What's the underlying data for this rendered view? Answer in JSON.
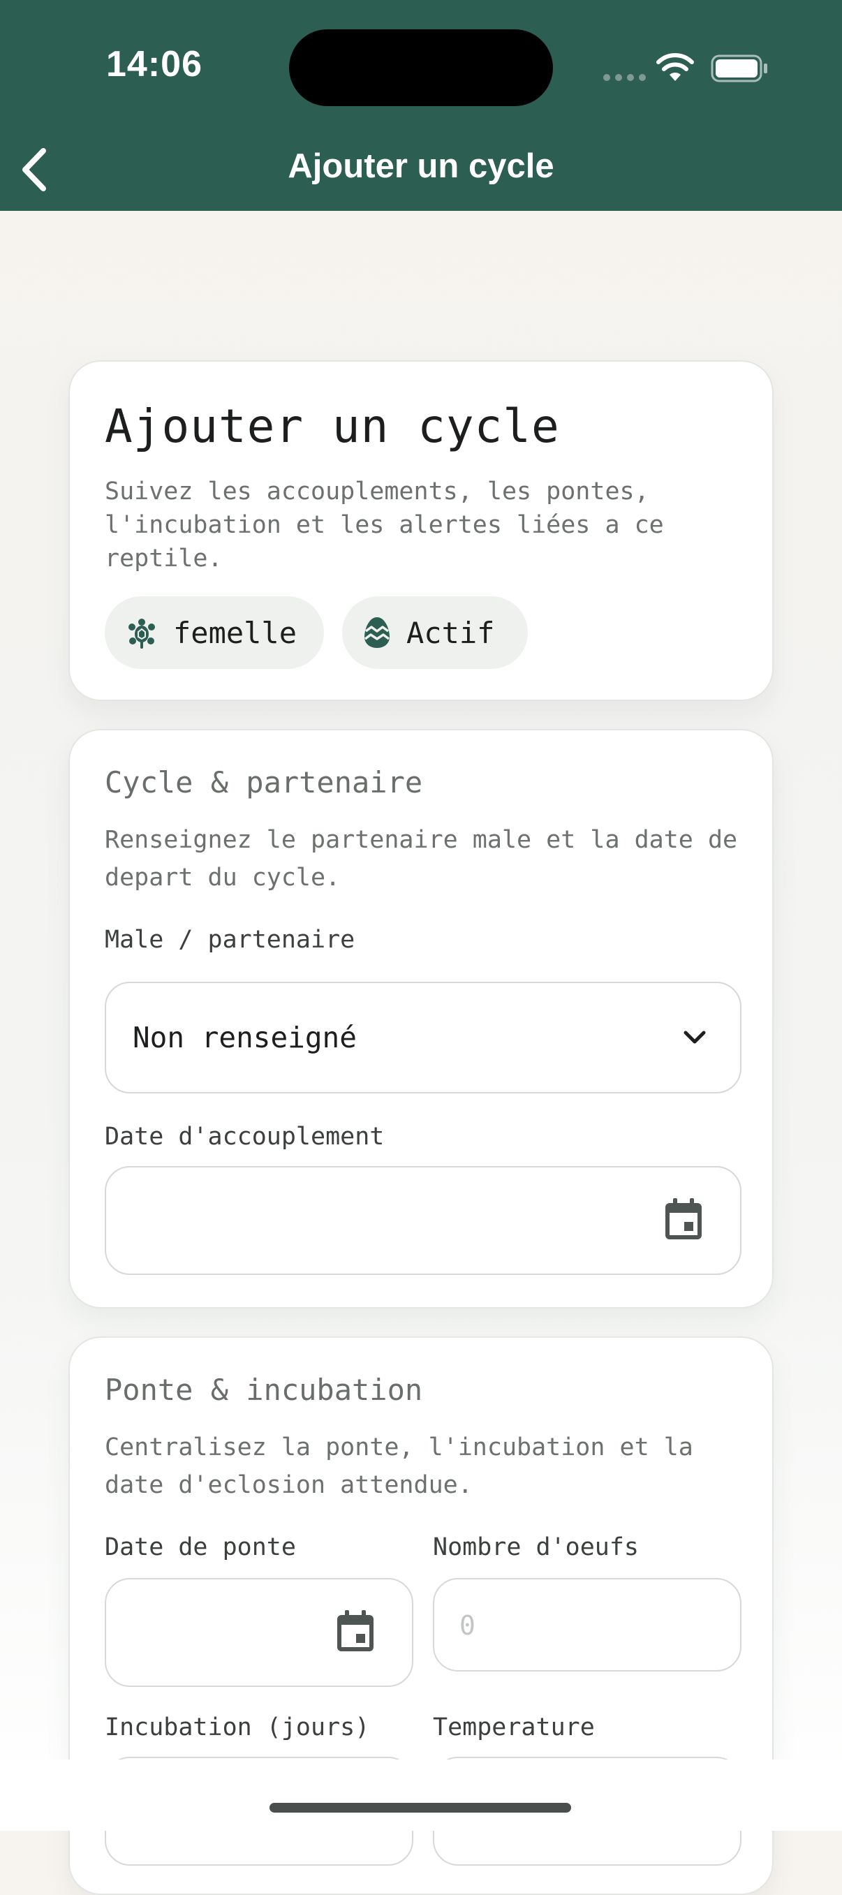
{
  "status_bar": {
    "time": "14:06"
  },
  "header": {
    "title": "Ajouter un cycle"
  },
  "hero": {
    "title": "Ajouter un cycle",
    "description": "Suivez les accouplements, les pontes, l'incubation et les alertes liées a ce reptile.",
    "chips": [
      {
        "label": "femelle",
        "icon": "turtle-icon"
      },
      {
        "label": "Actif",
        "icon": "egg-icon"
      }
    ]
  },
  "cycle_section": {
    "title": "Cycle & partenaire",
    "description": "Renseignez le partenaire male et la date de depart du cycle.",
    "male_label": "Male / partenaire",
    "male_value": "Non renseigné",
    "mating_date_label": "Date d'accouplement",
    "mating_date_value": ""
  },
  "ponte_section": {
    "title": "Ponte & incubation",
    "description": "Centralisez la ponte, l'incubation et la date d'eclosion attendue.",
    "laying_date_label": "Date de ponte",
    "eggs_label": "Nombre d'oeufs",
    "eggs_placeholder": "0",
    "incubation_label": "Incubation (jours)",
    "temperature_label": "Temperature"
  },
  "colors": {
    "header_bg": "#2c5e52",
    "accent": "#2c5e52",
    "chip_bg": "#eef1ee"
  }
}
